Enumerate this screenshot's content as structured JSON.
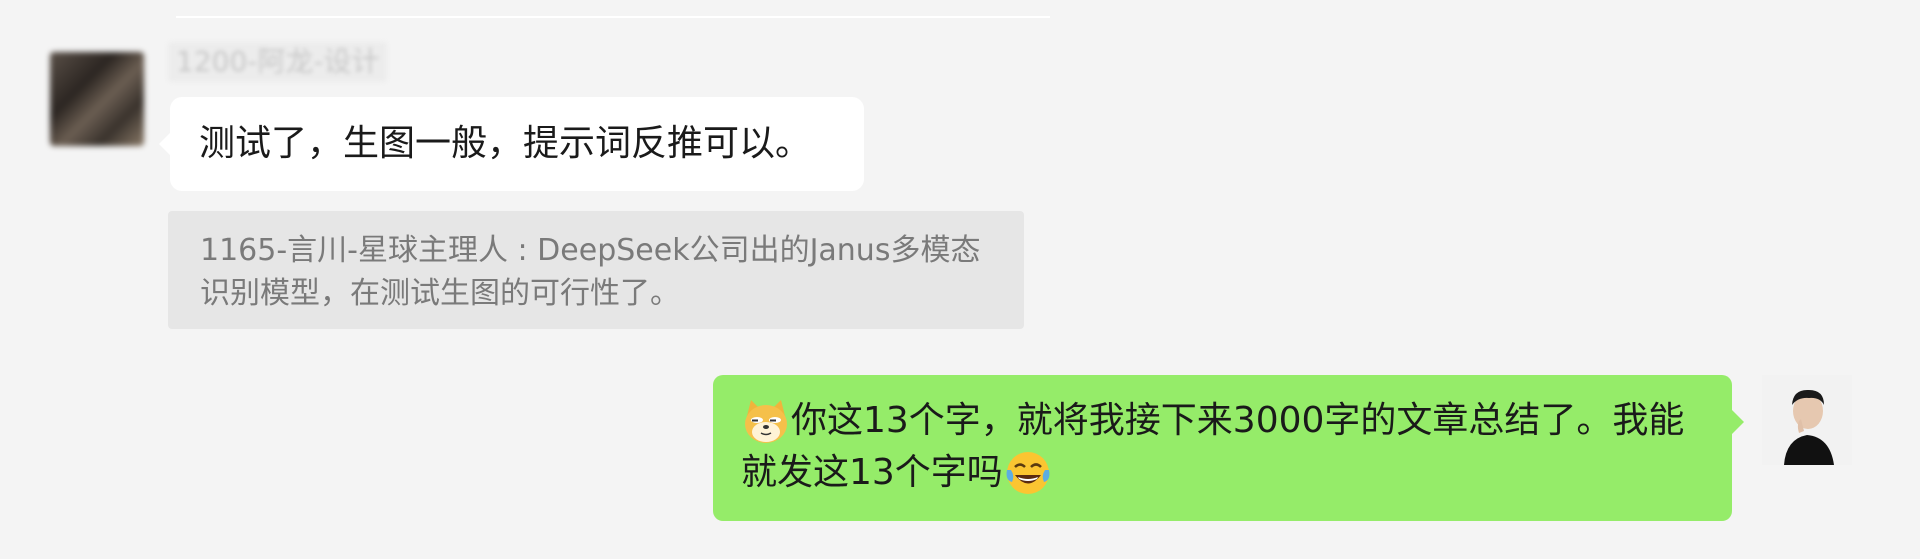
{
  "colors": {
    "background": "#f4f4f4",
    "incoming_bubble": "#ffffff",
    "outgoing_bubble": "#95ec69",
    "quote_background": "#e6e6e6",
    "quote_text": "#7a7a7a"
  },
  "chat": {
    "incoming": {
      "sender_name": "1200-阿龙-设计",
      "avatar_icon": "blurred-user-avatar",
      "text": "测试了，生图一般，提示词反推可以。"
    },
    "quote": {
      "line1": "1165-言川-星球主理人 : DeepSeek公司出的Janus多模态",
      "line2": "识别模型，在测试生图的可行性了。"
    },
    "outgoing": {
      "emoji_lead": "doge-emoji",
      "line1_text": "你这13个字，就将我接下来3000字的文章总结了。我能",
      "line2_text": "就发这13个字吗",
      "emoji_trail": "tears-of-joy-emoji",
      "avatar_icon": "user-avatar"
    }
  }
}
